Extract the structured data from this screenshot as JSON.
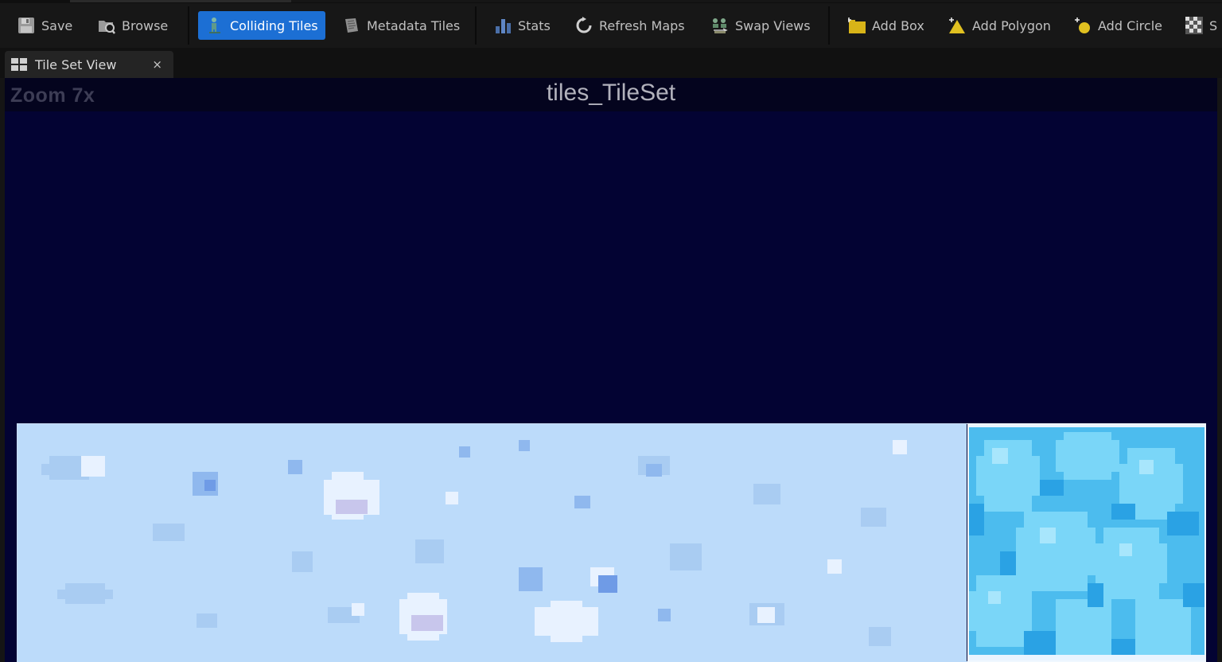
{
  "toolbar": {
    "save": "Save",
    "browse": "Browse",
    "colliding_tiles": "Colliding Tiles",
    "metadata_tiles": "Metadata Tiles",
    "stats": "Stats",
    "refresh_maps": "Refresh Maps",
    "swap_views": "Swap Views",
    "add_box": "Add Box",
    "add_polygon": "Add Polygon",
    "add_circle": "Add Circle",
    "cut_off": "S"
  },
  "tab": {
    "label": "Tile Set View",
    "close": "×"
  },
  "viewport": {
    "zoom": "Zoom 7x",
    "title": "tiles_TileSet"
  },
  "colors": {
    "accent_active": "#1c6fd4",
    "viewport_bg": "#030333",
    "snow_tile": "#bcdbfa",
    "ice_tile": "#4fc0ee"
  },
  "icons": {
    "save": "floppy-disk-icon",
    "browse": "folder-magnify-icon",
    "colliding_tiles": "person-collision-icon",
    "metadata_tiles": "document-icon",
    "stats": "bar-chart-icon",
    "refresh_maps": "refresh-icon",
    "swap_views": "swap-views-icon",
    "add_box": "folder-box-icon",
    "add_polygon": "triangle-plus-icon",
    "add_circle": "circle-plus-icon",
    "checker": "checkerboard-icon"
  }
}
